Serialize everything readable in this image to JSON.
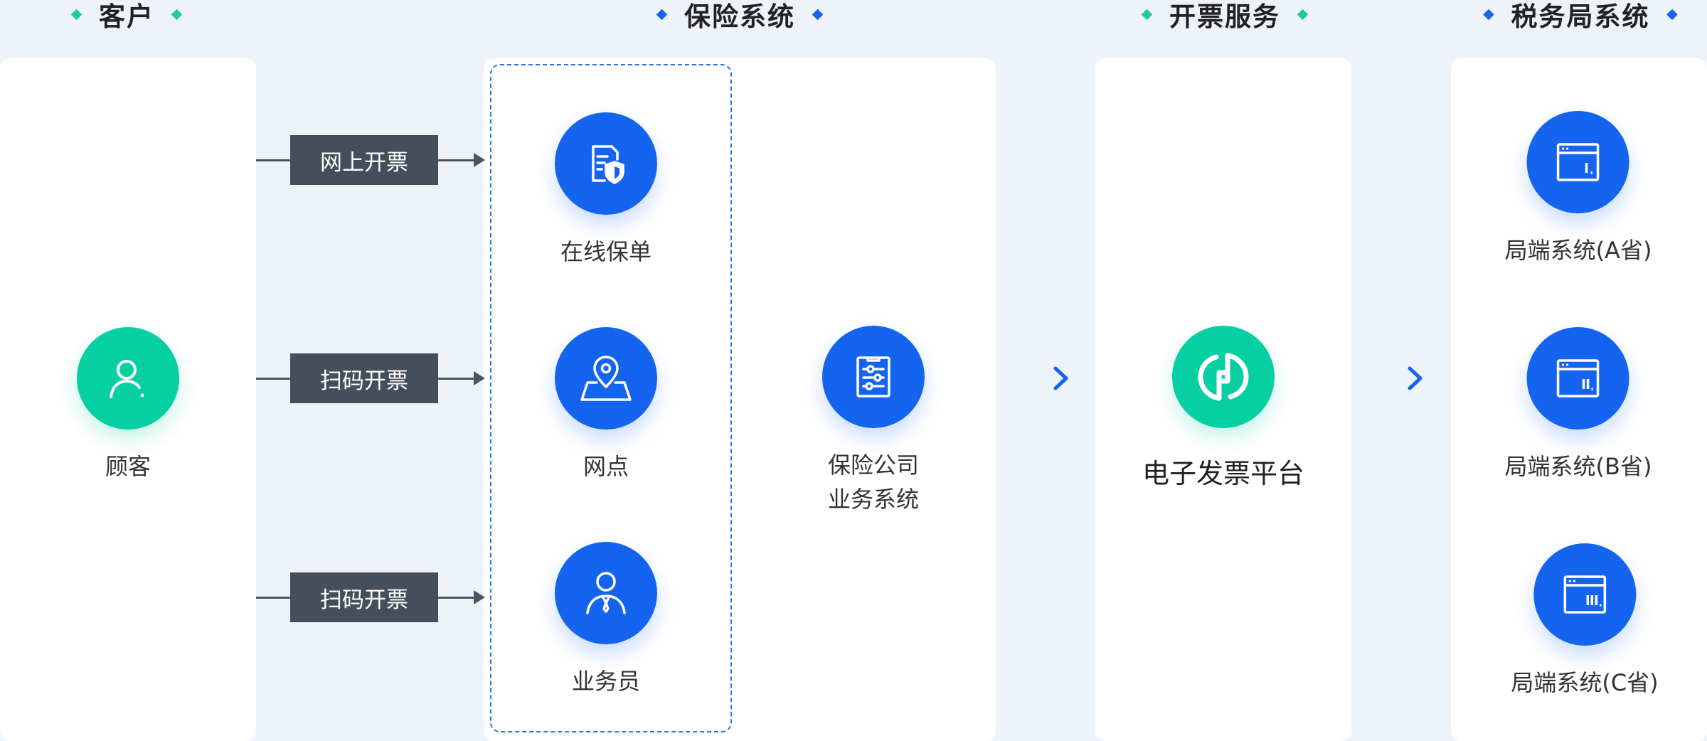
{
  "colors": {
    "background": "#EEF3FA",
    "panel": "#FFFFFF",
    "blue": "#1464F0",
    "green": "#06CFA3",
    "tag_bg": "#454F5B",
    "dashed_border": "#2F6FE8"
  },
  "headers": [
    {
      "title": "客户",
      "diamond_color": "#1FC9A6"
    },
    {
      "title": "保险系统",
      "diamond_color": "#1464F0"
    },
    {
      "title": "开票服务",
      "diamond_color": "#1FC9A6"
    },
    {
      "title": "税务局系统",
      "diamond_color": "#1464F0"
    }
  ],
  "customer": {
    "label": "顾客",
    "icon": "user-icon"
  },
  "channels": [
    {
      "tag": "网上开票"
    },
    {
      "tag": "扫码开票"
    },
    {
      "tag": "扫码开票"
    }
  ],
  "insurance_channels": [
    {
      "label": "在线保单",
      "icon": "policy-shield-icon"
    },
    {
      "label": "网点",
      "icon": "map-pin-icon"
    },
    {
      "label": "业务员",
      "icon": "agent-icon"
    }
  ],
  "insurance_company": {
    "label_line1": "保险公司",
    "label_line2": "业务系统",
    "icon": "clipboard-settings-icon"
  },
  "invoice_platform": {
    "label": "电子发票平台",
    "icon": "invoice-logo-icon"
  },
  "tax_systems": [
    {
      "label": "局端系统(A省)",
      "icon": "window-i-icon"
    },
    {
      "label": "局端系统(B省)",
      "icon": "window-ii-icon"
    },
    {
      "label": "局端系统(C省)",
      "icon": "window-iii-icon"
    }
  ]
}
